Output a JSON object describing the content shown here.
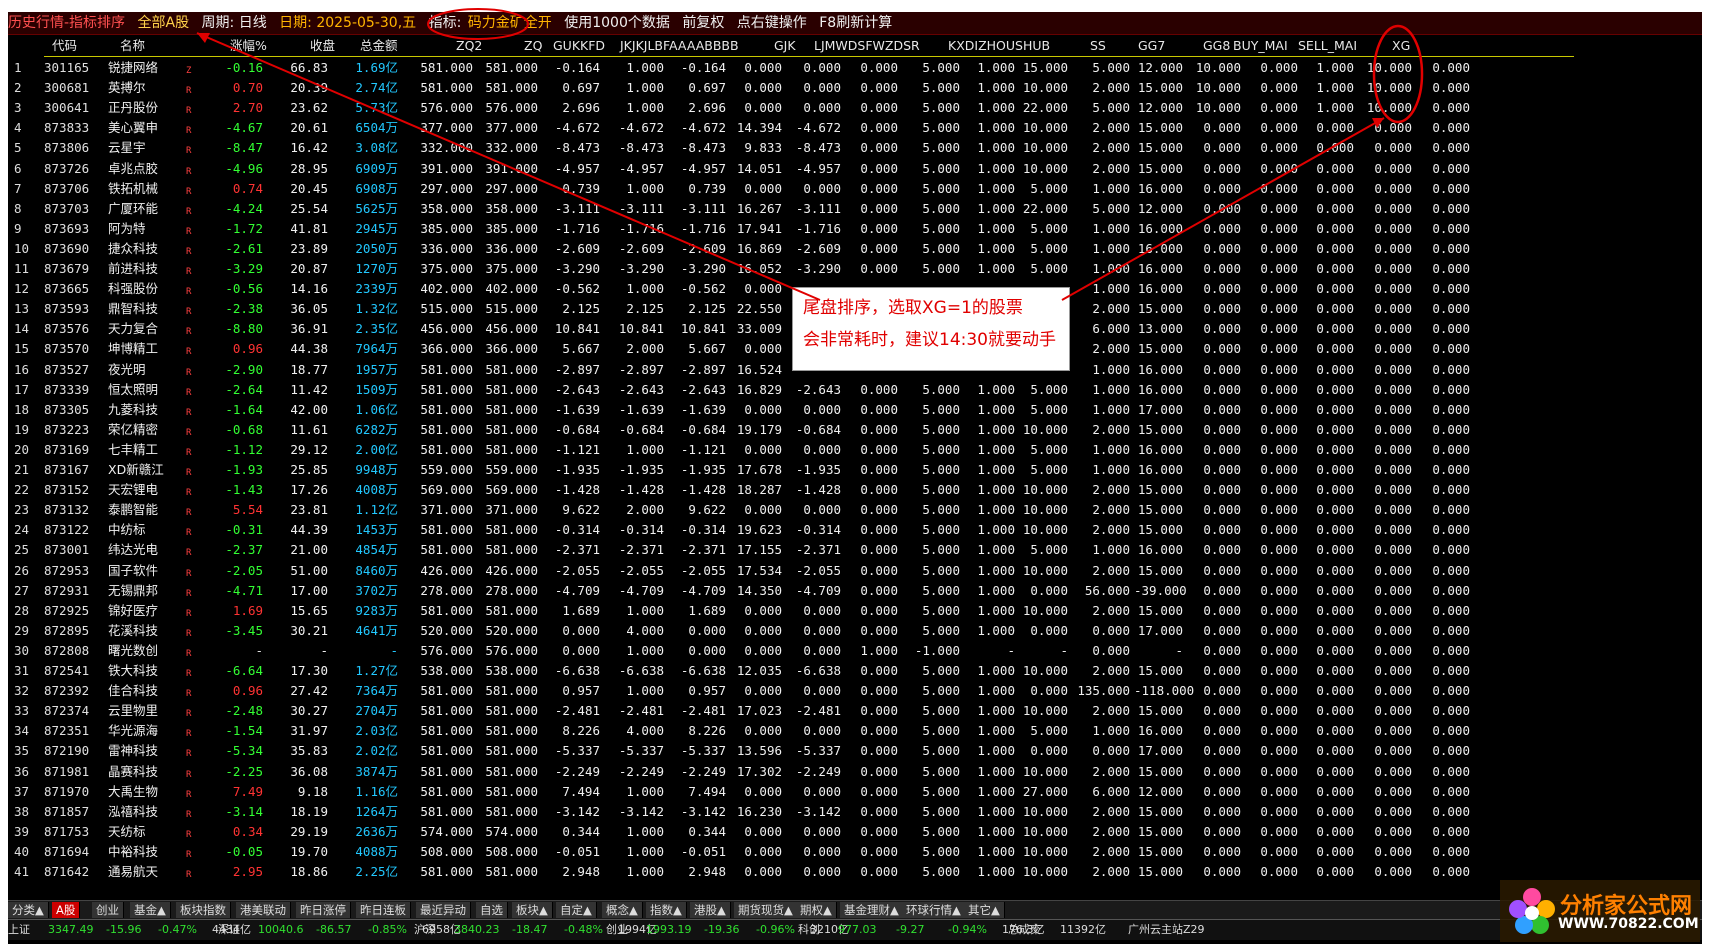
{
  "titlebar": {
    "app_title": "历史行情-指标排序",
    "market": "全部A股",
    "period": "周期: 日线",
    "date": "日期: 2025-05-30,五",
    "indicator_label": "指标:",
    "indicator_name": "码力金矿全开",
    "data_text": "使用1000个数据",
    "adjust": "前复权",
    "right_click": "点右键操作",
    "refresh": "F8刷新计算"
  },
  "columns": [
    "代码",
    "名称",
    "涨幅%",
    "收盘",
    "总金额",
    "ZQ2",
    "ZQ",
    "GUKKFD",
    "JKJKJLBFAAAABBBB",
    "GJK",
    "LJMWDSFWZDSR",
    "KXDIZHOUSHUB",
    "SS",
    "GG7",
    "GG8",
    "BUY_MAI",
    "SELL_MAI",
    "XG"
  ],
  "rows": [
    [
      "1",
      "301165",
      "锐捷网络",
      "Z",
      "-0.16",
      "66.83",
      "1.69亿",
      "581.000",
      "581.000",
      "-0.164",
      "1.000",
      "-0.164",
      "0.000",
      "0.000",
      "0.000",
      "5.000",
      "1.000",
      "15.000",
      "5.000",
      "12.000",
      "10.000",
      "0.000",
      "1.000",
      "10.000",
      "0.000"
    ],
    [
      "2",
      "300681",
      "英搏尔",
      "R",
      "0.70",
      "20.39",
      "2.74亿",
      "581.000",
      "581.000",
      "0.697",
      "1.000",
      "0.697",
      "0.000",
      "0.000",
      "0.000",
      "5.000",
      "1.000",
      "10.000",
      "2.000",
      "15.000",
      "10.000",
      "0.000",
      "1.000",
      "10.000",
      "0.000"
    ],
    [
      "3",
      "300641",
      "正丹股份",
      "R",
      "2.70",
      "23.62",
      "5.73亿",
      "576.000",
      "576.000",
      "2.696",
      "1.000",
      "2.696",
      "0.000",
      "0.000",
      "0.000",
      "5.000",
      "1.000",
      "22.000",
      "5.000",
      "12.000",
      "10.000",
      "0.000",
      "1.000",
      "10.000",
      "0.000"
    ],
    [
      "4",
      "873833",
      "美心翼申",
      "R",
      "-4.67",
      "20.61",
      "6504万",
      "377.000",
      "377.000",
      "-4.672",
      "-4.672",
      "-4.672",
      "14.394",
      "-4.672",
      "0.000",
      "5.000",
      "1.000",
      "10.000",
      "2.000",
      "15.000",
      "0.000",
      "0.000",
      "0.000",
      "0.000",
      "0.000"
    ],
    [
      "5",
      "873806",
      "云星宇",
      "R",
      "-8.47",
      "16.42",
      "3.08亿",
      "332.000",
      "332.000",
      "-8.473",
      "-8.473",
      "-8.473",
      "9.833",
      "-8.473",
      "0.000",
      "5.000",
      "1.000",
      "10.000",
      "2.000",
      "15.000",
      "0.000",
      "0.000",
      "0.000",
      "0.000",
      "0.000"
    ],
    [
      "6",
      "873726",
      "卓兆点胶",
      "R",
      "-4.96",
      "28.95",
      "6909万",
      "391.000",
      "391.000",
      "-4.957",
      "-4.957",
      "-4.957",
      "14.051",
      "-4.957",
      "0.000",
      "5.000",
      "1.000",
      "10.000",
      "2.000",
      "15.000",
      "0.000",
      "0.000",
      "0.000",
      "0.000",
      "0.000"
    ],
    [
      "7",
      "873706",
      "铁拓机械",
      "R",
      "0.74",
      "20.45",
      "6908万",
      "297.000",
      "297.000",
      "0.739",
      "1.000",
      "0.739",
      "0.000",
      "0.000",
      "0.000",
      "5.000",
      "1.000",
      "5.000",
      "1.000",
      "16.000",
      "0.000",
      "0.000",
      "0.000",
      "0.000",
      "0.000"
    ],
    [
      "8",
      "873703",
      "广厦环能",
      "R",
      "-4.24",
      "25.54",
      "5625万",
      "358.000",
      "358.000",
      "-3.111",
      "-3.111",
      "-3.111",
      "16.267",
      "-3.111",
      "0.000",
      "5.000",
      "1.000",
      "22.000",
      "5.000",
      "12.000",
      "0.000",
      "0.000",
      "0.000",
      "0.000",
      "0.000"
    ],
    [
      "9",
      "873693",
      "阿为特",
      "R",
      "-1.72",
      "41.81",
      "2945万",
      "385.000",
      "385.000",
      "-1.716",
      "-1.716",
      "-1.716",
      "17.941",
      "-1.716",
      "0.000",
      "5.000",
      "1.000",
      "5.000",
      "1.000",
      "16.000",
      "0.000",
      "0.000",
      "0.000",
      "0.000",
      "0.000"
    ],
    [
      "10",
      "873690",
      "捷众科技",
      "R",
      "-2.61",
      "23.89",
      "2050万",
      "336.000",
      "336.000",
      "-2.609",
      "-2.609",
      "-2.609",
      "16.869",
      "-2.609",
      "0.000",
      "5.000",
      "1.000",
      "5.000",
      "1.000",
      "16.000",
      "0.000",
      "0.000",
      "0.000",
      "0.000",
      "0.000"
    ],
    [
      "11",
      "873679",
      "前进科技",
      "R",
      "-3.29",
      "20.87",
      "1270万",
      "375.000",
      "375.000",
      "-3.290",
      "-3.290",
      "-3.290",
      "16.052",
      "-3.290",
      "0.000",
      "5.000",
      "1.000",
      "5.000",
      "1.000",
      "16.000",
      "0.000",
      "0.000",
      "0.000",
      "0.000",
      "0.000"
    ],
    [
      "12",
      "873665",
      "科强股份",
      "R",
      "-0.56",
      "14.16",
      "2339万",
      "402.000",
      "402.000",
      "-0.562",
      "1.000",
      "-0.562",
      "0.000",
      "",
      "",
      "",
      "",
      "",
      "1.000",
      "16.000",
      "0.000",
      "0.000",
      "0.000",
      "0.000",
      "0.000"
    ],
    [
      "13",
      "873593",
      "鼎智科技",
      "R",
      "-2.38",
      "36.05",
      "1.32亿",
      "515.000",
      "515.000",
      "2.125",
      "2.125",
      "2.125",
      "22.550",
      "",
      "",
      "",
      "",
      "",
      "2.000",
      "15.000",
      "0.000",
      "0.000",
      "0.000",
      "0.000",
      "0.000"
    ],
    [
      "14",
      "873576",
      "天力复合",
      "R",
      "-8.80",
      "36.91",
      "2.35亿",
      "456.000",
      "456.000",
      "10.841",
      "10.841",
      "10.841",
      "33.009",
      "",
      "",
      "",
      "",
      "",
      "6.000",
      "13.000",
      "0.000",
      "0.000",
      "0.000",
      "0.000",
      "0.000"
    ],
    [
      "15",
      "873570",
      "坤博精工",
      "R",
      "0.96",
      "44.38",
      "7964万",
      "366.000",
      "366.000",
      "5.667",
      "2.000",
      "5.667",
      "0.000",
      "",
      "",
      "",
      "",
      "",
      "2.000",
      "15.000",
      "0.000",
      "0.000",
      "0.000",
      "0.000",
      "0.000"
    ],
    [
      "16",
      "873527",
      "夜光明",
      "R",
      "-2.90",
      "18.77",
      "1957万",
      "581.000",
      "581.000",
      "-2.897",
      "-2.897",
      "-2.897",
      "16.524",
      "",
      "",
      "",
      "",
      "",
      "1.000",
      "16.000",
      "0.000",
      "0.000",
      "0.000",
      "0.000",
      "0.000"
    ],
    [
      "17",
      "873339",
      "恒太照明",
      "R",
      "-2.64",
      "11.42",
      "1509万",
      "581.000",
      "581.000",
      "-2.643",
      "-2.643",
      "-2.643",
      "16.829",
      "-2.643",
      "0.000",
      "5.000",
      "1.000",
      "5.000",
      "1.000",
      "16.000",
      "0.000",
      "0.000",
      "0.000",
      "0.000",
      "0.000"
    ],
    [
      "18",
      "873305",
      "九菱科技",
      "R",
      "-1.64",
      "42.00",
      "1.06亿",
      "581.000",
      "581.000",
      "-1.639",
      "-1.639",
      "-1.639",
      "0.000",
      "0.000",
      "0.000",
      "5.000",
      "1.000",
      "5.000",
      "1.000",
      "17.000",
      "0.000",
      "0.000",
      "0.000",
      "0.000",
      "0.000"
    ],
    [
      "19",
      "873223",
      "荣亿精密",
      "R",
      "-0.68",
      "11.61",
      "6282万",
      "581.000",
      "581.000",
      "-0.684",
      "-0.684",
      "-0.684",
      "19.179",
      "-0.684",
      "0.000",
      "5.000",
      "1.000",
      "10.000",
      "2.000",
      "15.000",
      "0.000",
      "0.000",
      "0.000",
      "0.000",
      "0.000"
    ],
    [
      "20",
      "873169",
      "七丰精工",
      "R",
      "-1.12",
      "29.12",
      "2.00亿",
      "581.000",
      "581.000",
      "-1.121",
      "1.000",
      "-1.121",
      "0.000",
      "0.000",
      "0.000",
      "5.000",
      "1.000",
      "5.000",
      "1.000",
      "16.000",
      "0.000",
      "0.000",
      "0.000",
      "0.000",
      "0.000"
    ],
    [
      "21",
      "873167",
      "XD新赣江",
      "R",
      "-1.93",
      "25.85",
      "9948万",
      "559.000",
      "559.000",
      "-1.935",
      "-1.935",
      "-1.935",
      "17.678",
      "-1.935",
      "0.000",
      "5.000",
      "1.000",
      "5.000",
      "1.000",
      "16.000",
      "0.000",
      "0.000",
      "0.000",
      "0.000",
      "0.000"
    ],
    [
      "22",
      "873152",
      "天宏锂电",
      "R",
      "-1.43",
      "17.26",
      "4008万",
      "569.000",
      "569.000",
      "-1.428",
      "-1.428",
      "-1.428",
      "18.287",
      "-1.428",
      "0.000",
      "5.000",
      "1.000",
      "10.000",
      "2.000",
      "15.000",
      "0.000",
      "0.000",
      "0.000",
      "0.000",
      "0.000"
    ],
    [
      "23",
      "873132",
      "泰鹏智能",
      "R",
      "5.54",
      "23.81",
      "1.12亿",
      "371.000",
      "371.000",
      "9.622",
      "2.000",
      "9.622",
      "0.000",
      "0.000",
      "0.000",
      "5.000",
      "1.000",
      "10.000",
      "2.000",
      "15.000",
      "0.000",
      "0.000",
      "0.000",
      "0.000",
      "0.000"
    ],
    [
      "24",
      "873122",
      "中纺标",
      "R",
      "-0.31",
      "44.39",
      "1453万",
      "581.000",
      "581.000",
      "-0.314",
      "-0.314",
      "-0.314",
      "19.623",
      "-0.314",
      "0.000",
      "5.000",
      "1.000",
      "10.000",
      "2.000",
      "15.000",
      "0.000",
      "0.000",
      "0.000",
      "0.000",
      "0.000"
    ],
    [
      "25",
      "873001",
      "纬达光电",
      "R",
      "-2.37",
      "21.00",
      "4854万",
      "581.000",
      "581.000",
      "-2.371",
      "-2.371",
      "-2.371",
      "17.155",
      "-2.371",
      "0.000",
      "5.000",
      "1.000",
      "5.000",
      "1.000",
      "16.000",
      "0.000",
      "0.000",
      "0.000",
      "0.000",
      "0.000"
    ],
    [
      "26",
      "872953",
      "国子软件",
      "R",
      "-2.05",
      "51.00",
      "8460万",
      "426.000",
      "426.000",
      "-2.055",
      "-2.055",
      "-2.055",
      "17.534",
      "-2.055",
      "0.000",
      "5.000",
      "1.000",
      "10.000",
      "2.000",
      "15.000",
      "0.000",
      "0.000",
      "0.000",
      "0.000",
      "0.000"
    ],
    [
      "27",
      "872931",
      "无锡鼎邦",
      "R",
      "-4.71",
      "17.00",
      "3702万",
      "278.000",
      "278.000",
      "-4.709",
      "-4.709",
      "-4.709",
      "14.350",
      "-4.709",
      "0.000",
      "5.000",
      "1.000",
      "0.000",
      "56.000",
      "-39.000",
      "0.000",
      "0.000",
      "0.000",
      "0.000",
      "0.000"
    ],
    [
      "28",
      "872925",
      "锦好医疗",
      "R",
      "1.69",
      "15.65",
      "9283万",
      "581.000",
      "581.000",
      "1.689",
      "1.000",
      "1.689",
      "0.000",
      "0.000",
      "0.000",
      "5.000",
      "1.000",
      "10.000",
      "2.000",
      "15.000",
      "0.000",
      "0.000",
      "0.000",
      "0.000",
      "0.000"
    ],
    [
      "29",
      "872895",
      "花溪科技",
      "R",
      "-3.45",
      "30.21",
      "4641万",
      "520.000",
      "520.000",
      "0.000",
      "4.000",
      "0.000",
      "0.000",
      "0.000",
      "0.000",
      "5.000",
      "1.000",
      "0.000",
      "0.000",
      "17.000",
      "0.000",
      "0.000",
      "0.000",
      "0.000",
      "0.000"
    ],
    [
      "30",
      "872808",
      "曙光数创",
      "R",
      "-",
      "-",
      "-",
      "576.000",
      "576.000",
      "0.000",
      "1.000",
      "0.000",
      "0.000",
      "0.000",
      "1.000",
      "-1.000",
      "-",
      "-",
      "0.000",
      "-",
      "0.000",
      "0.000",
      "0.000",
      "0.000",
      "0.000"
    ],
    [
      "31",
      "872541",
      "铁大科技",
      "R",
      "-6.64",
      "17.30",
      "1.27亿",
      "538.000",
      "538.000",
      "-6.638",
      "-6.638",
      "-6.638",
      "12.035",
      "-6.638",
      "0.000",
      "5.000",
      "1.000",
      "10.000",
      "2.000",
      "15.000",
      "0.000",
      "0.000",
      "0.000",
      "0.000",
      "0.000"
    ],
    [
      "32",
      "872392",
      "佳合科技",
      "R",
      "0.96",
      "27.42",
      "7364万",
      "581.000",
      "581.000",
      "0.957",
      "1.000",
      "0.957",
      "0.000",
      "0.000",
      "0.000",
      "5.000",
      "1.000",
      "0.000",
      "135.000",
      "-118.000",
      "0.000",
      "0.000",
      "0.000",
      "0.000",
      "0.000"
    ],
    [
      "33",
      "872374",
      "云里物里",
      "R",
      "-2.48",
      "30.27",
      "2704万",
      "581.000",
      "581.000",
      "-2.481",
      "-2.481",
      "-2.481",
      "17.023",
      "-2.481",
      "0.000",
      "5.000",
      "1.000",
      "10.000",
      "2.000",
      "15.000",
      "0.000",
      "0.000",
      "0.000",
      "0.000",
      "0.000"
    ],
    [
      "34",
      "872351",
      "华光源海",
      "R",
      "-1.54",
      "31.97",
      "2.03亿",
      "581.000",
      "581.000",
      "8.226",
      "4.000",
      "8.226",
      "0.000",
      "0.000",
      "0.000",
      "5.000",
      "1.000",
      "5.000",
      "1.000",
      "16.000",
      "0.000",
      "0.000",
      "0.000",
      "0.000",
      "0.000"
    ],
    [
      "35",
      "872190",
      "雷神科技",
      "R",
      "-5.34",
      "35.83",
      "2.02亿",
      "581.000",
      "581.000",
      "-5.337",
      "-5.337",
      "-5.337",
      "13.596",
      "-5.337",
      "0.000",
      "5.000",
      "1.000",
      "0.000",
      "0.000",
      "17.000",
      "0.000",
      "0.000",
      "0.000",
      "0.000",
      "0.000"
    ],
    [
      "36",
      "871981",
      "晶赛科技",
      "R",
      "-2.25",
      "36.08",
      "3874万",
      "581.000",
      "581.000",
      "-2.249",
      "-2.249",
      "-2.249",
      "17.302",
      "-2.249",
      "0.000",
      "5.000",
      "1.000",
      "10.000",
      "2.000",
      "15.000",
      "0.000",
      "0.000",
      "0.000",
      "0.000",
      "0.000"
    ],
    [
      "37",
      "871970",
      "大禹生物",
      "R",
      "7.49",
      "9.18",
      "1.16亿",
      "581.000",
      "581.000",
      "7.494",
      "1.000",
      "7.494",
      "0.000",
      "0.000",
      "0.000",
      "5.000",
      "1.000",
      "27.000",
      "6.000",
      "12.000",
      "0.000",
      "0.000",
      "0.000",
      "0.000",
      "0.000"
    ],
    [
      "38",
      "871857",
      "泓禧科技",
      "R",
      "-3.14",
      "18.19",
      "1264万",
      "581.000",
      "581.000",
      "-3.142",
      "-3.142",
      "-3.142",
      "16.230",
      "-3.142",
      "0.000",
      "5.000",
      "1.000",
      "10.000",
      "2.000",
      "15.000",
      "0.000",
      "0.000",
      "0.000",
      "0.000",
      "0.000"
    ],
    [
      "39",
      "871753",
      "天纺标",
      "R",
      "0.34",
      "29.19",
      "2636万",
      "574.000",
      "574.000",
      "0.344",
      "1.000",
      "0.344",
      "0.000",
      "0.000",
      "0.000",
      "5.000",
      "1.000",
      "10.000",
      "2.000",
      "15.000",
      "0.000",
      "0.000",
      "0.000",
      "0.000",
      "0.000"
    ],
    [
      "40",
      "871694",
      "中裕科技",
      "R",
      "-0.05",
      "19.70",
      "4088万",
      "508.000",
      "508.000",
      "-0.051",
      "1.000",
      "-0.051",
      "0.000",
      "0.000",
      "0.000",
      "5.000",
      "1.000",
      "10.000",
      "2.000",
      "15.000",
      "0.000",
      "0.000",
      "0.000",
      "0.000",
      "0.000"
    ],
    [
      "41",
      "871642",
      "通易航天",
      "R",
      "2.95",
      "18.86",
      "2.25亿",
      "581.000",
      "581.000",
      "2.948",
      "1.000",
      "2.948",
      "0.000",
      "0.000",
      "0.000",
      "5.000",
      "1.000",
      "10.000",
      "2.000",
      "15.000",
      "0.000",
      "0.000",
      "0.000",
      "0.000",
      "0.000"
    ]
  ],
  "tabs": [
    "分类▲",
    "A股",
    "创业",
    "基金▲",
    "板块指数",
    "港美联动",
    "昨日涨停",
    "昨日连板",
    "最近异动",
    "自选",
    "板块▲",
    "自定▲",
    "概念▲",
    "指数▲",
    "港股▲",
    "期货现货▲",
    "期权▲",
    "基金理财▲",
    "环球行情▲",
    "其它▲"
  ],
  "active_tab": "A股",
  "statusbar": [
    {
      "label": "上证",
      "value": "3347.49",
      "change": "-15.96",
      "pct": "-0.47%",
      "amount": "4434亿"
    },
    {
      "label": "深证",
      "value": "10040.6",
      "change": "-86.57",
      "pct": "-0.85%",
      "amount": "6958亿"
    },
    {
      "label": "沪深",
      "value": "3840.23",
      "change": "-18.47",
      "pct": "-0.48%",
      "amount": "1994亿"
    },
    {
      "label": "创业",
      "value": "1993.19",
      "change": "-19.36",
      "pct": "-0.96%",
      "amount": "3210亿"
    },
    {
      "label": "科创",
      "value": "977.03",
      "change": "-9.27",
      "pct": "-0.94%",
      "amount": "176.3亿"
    }
  ],
  "status_total_label": "总成交",
  "status_total_value": "11392亿",
  "status_server": "广州云主站Z29",
  "callout": {
    "line1": "尾盘排序，选取XG=1的股票",
    "line2": "会非常耗时，建议14:30就要动手"
  },
  "logo": {
    "name": "分析家公式网",
    "url": "WWW.70822.COM"
  },
  "colors": {
    "background": "#000000",
    "up": "#ff3333",
    "down": "#33ff33",
    "amount": "#22c8ff",
    "annotation": "#e00000",
    "title_accent": "#ffd24a"
  }
}
